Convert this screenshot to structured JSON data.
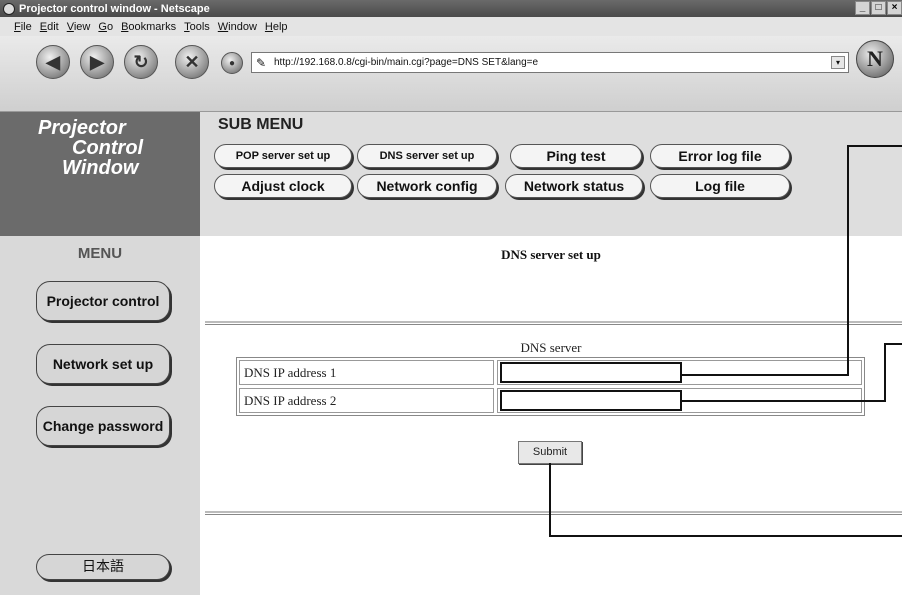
{
  "window": {
    "title": "Projector control window - Netscape",
    "controls": [
      "_",
      "□",
      "×"
    ]
  },
  "menubar": [
    "File",
    "Edit",
    "View",
    "Go",
    "Bookmarks",
    "Tools",
    "Window",
    "Help"
  ],
  "navbar": {
    "url": "http://192.168.0.8/cgi-bin/main.cgi?page=DNS SET&lang=e",
    "logo": "N"
  },
  "brand": {
    "line1": "Projector",
    "line2": "Control",
    "line3": "Window"
  },
  "submenu": {
    "title": "SUB MENU",
    "buttons": [
      "POP server set up",
      "DNS server set up",
      "Ping test",
      "Error log file",
      "Adjust clock",
      "Network config",
      "Network status",
      "Log file"
    ]
  },
  "menu": {
    "title": "MENU",
    "buttons": [
      "Projector control",
      "Network set up",
      "Change password",
      "日本語"
    ]
  },
  "main": {
    "title": "DNS server set up",
    "section_label": "DNS server",
    "rows": [
      {
        "label": "DNS IP address 1",
        "value": ""
      },
      {
        "label": "DNS IP address 2",
        "value": ""
      }
    ],
    "submit_label": "Submit"
  }
}
